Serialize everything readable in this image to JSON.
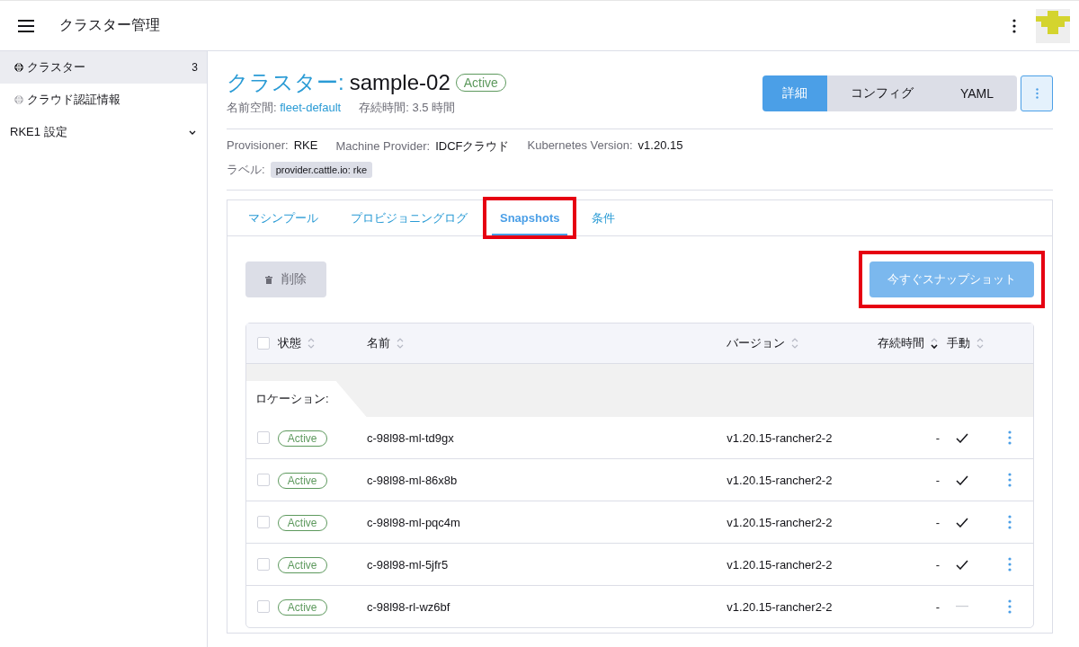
{
  "header": {
    "title": "クラスター管理"
  },
  "sidebar": {
    "items": [
      {
        "label": "クラスター",
        "count": "3",
        "selected": true
      },
      {
        "label": "クラウド認証情報",
        "selected": false
      }
    ],
    "groups": [
      {
        "label": "RKE1 設定",
        "expanded": false
      }
    ]
  },
  "cluster": {
    "type_label": "クラスター:",
    "name": "sample-02",
    "status": "Active",
    "namespace_label": "名前空間:",
    "namespace": "fleet-default",
    "age_label": "存続時間:",
    "age": "3.5 時間"
  },
  "view_buttons": [
    {
      "label": "詳細",
      "selected": true
    },
    {
      "label": "コンフィグ",
      "selected": false
    },
    {
      "label": "YAML",
      "selected": false
    }
  ],
  "details": [
    {
      "label": "Provisioner:",
      "value": "RKE"
    },
    {
      "label": "Machine Provider:",
      "value": "IDCFクラウド"
    },
    {
      "label": "Kubernetes Version:",
      "value": "v1.20.15"
    }
  ],
  "labels": {
    "label": "ラベル:",
    "tags": [
      "provider.cattle.io: rke"
    ]
  },
  "tabs": [
    {
      "label": "マシンプール",
      "selected": false,
      "highlighted": false
    },
    {
      "label": "プロビジョニングログ",
      "selected": false,
      "highlighted": false
    },
    {
      "label": "Snapshots",
      "selected": true,
      "highlighted": true
    },
    {
      "label": "条件",
      "selected": false,
      "highlighted": false
    }
  ],
  "delete_button": {
    "label": "削除",
    "disabled": true
  },
  "snapshot_button": {
    "label": "今すぐスナップショット",
    "highlighted": true
  },
  "table": {
    "select_all_checked": false,
    "columns": [
      {
        "label": "状態",
        "sorted": false
      },
      {
        "label": "名前",
        "sorted": false
      },
      {
        "label": "バージョン",
        "sorted": false
      },
      {
        "label": "存続時間",
        "sorted": true
      },
      {
        "label": "手動",
        "sorted": false
      }
    ],
    "group_label": "ロケーション:",
    "rows": [
      {
        "checked": false,
        "status": "Active",
        "name": "c-98l98-ml-td9gx",
        "version": "v1.20.15-rancher2-2",
        "age": "-",
        "manual": true
      },
      {
        "checked": false,
        "status": "Active",
        "name": "c-98l98-ml-86x8b",
        "version": "v1.20.15-rancher2-2",
        "age": "-",
        "manual": true
      },
      {
        "checked": false,
        "status": "Active",
        "name": "c-98l98-ml-pqc4m",
        "version": "v1.20.15-rancher2-2",
        "age": "-",
        "manual": true
      },
      {
        "checked": false,
        "status": "Active",
        "name": "c-98l98-ml-5jfr5",
        "version": "v1.20.15-rancher2-2",
        "age": "-",
        "manual": true
      },
      {
        "checked": false,
        "status": "Active",
        "name": "c-98l98-rl-wz6bf",
        "version": "v1.20.15-rancher2-2",
        "age": "-",
        "manual": false
      }
    ]
  }
}
